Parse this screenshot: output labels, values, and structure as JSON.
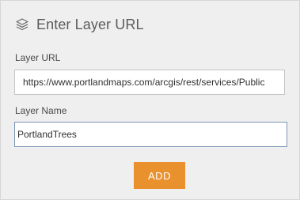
{
  "panel": {
    "title": "Enter Layer URL",
    "title_icon": "layers-icon"
  },
  "url_field": {
    "label": "Layer URL",
    "value": "https://www.portlandmaps.com/arcgis/rest/services/Public"
  },
  "name_field": {
    "label": "Layer Name",
    "value": "PortlandTrees"
  },
  "add_button": {
    "label": "ADD",
    "color": "#e9912d"
  }
}
